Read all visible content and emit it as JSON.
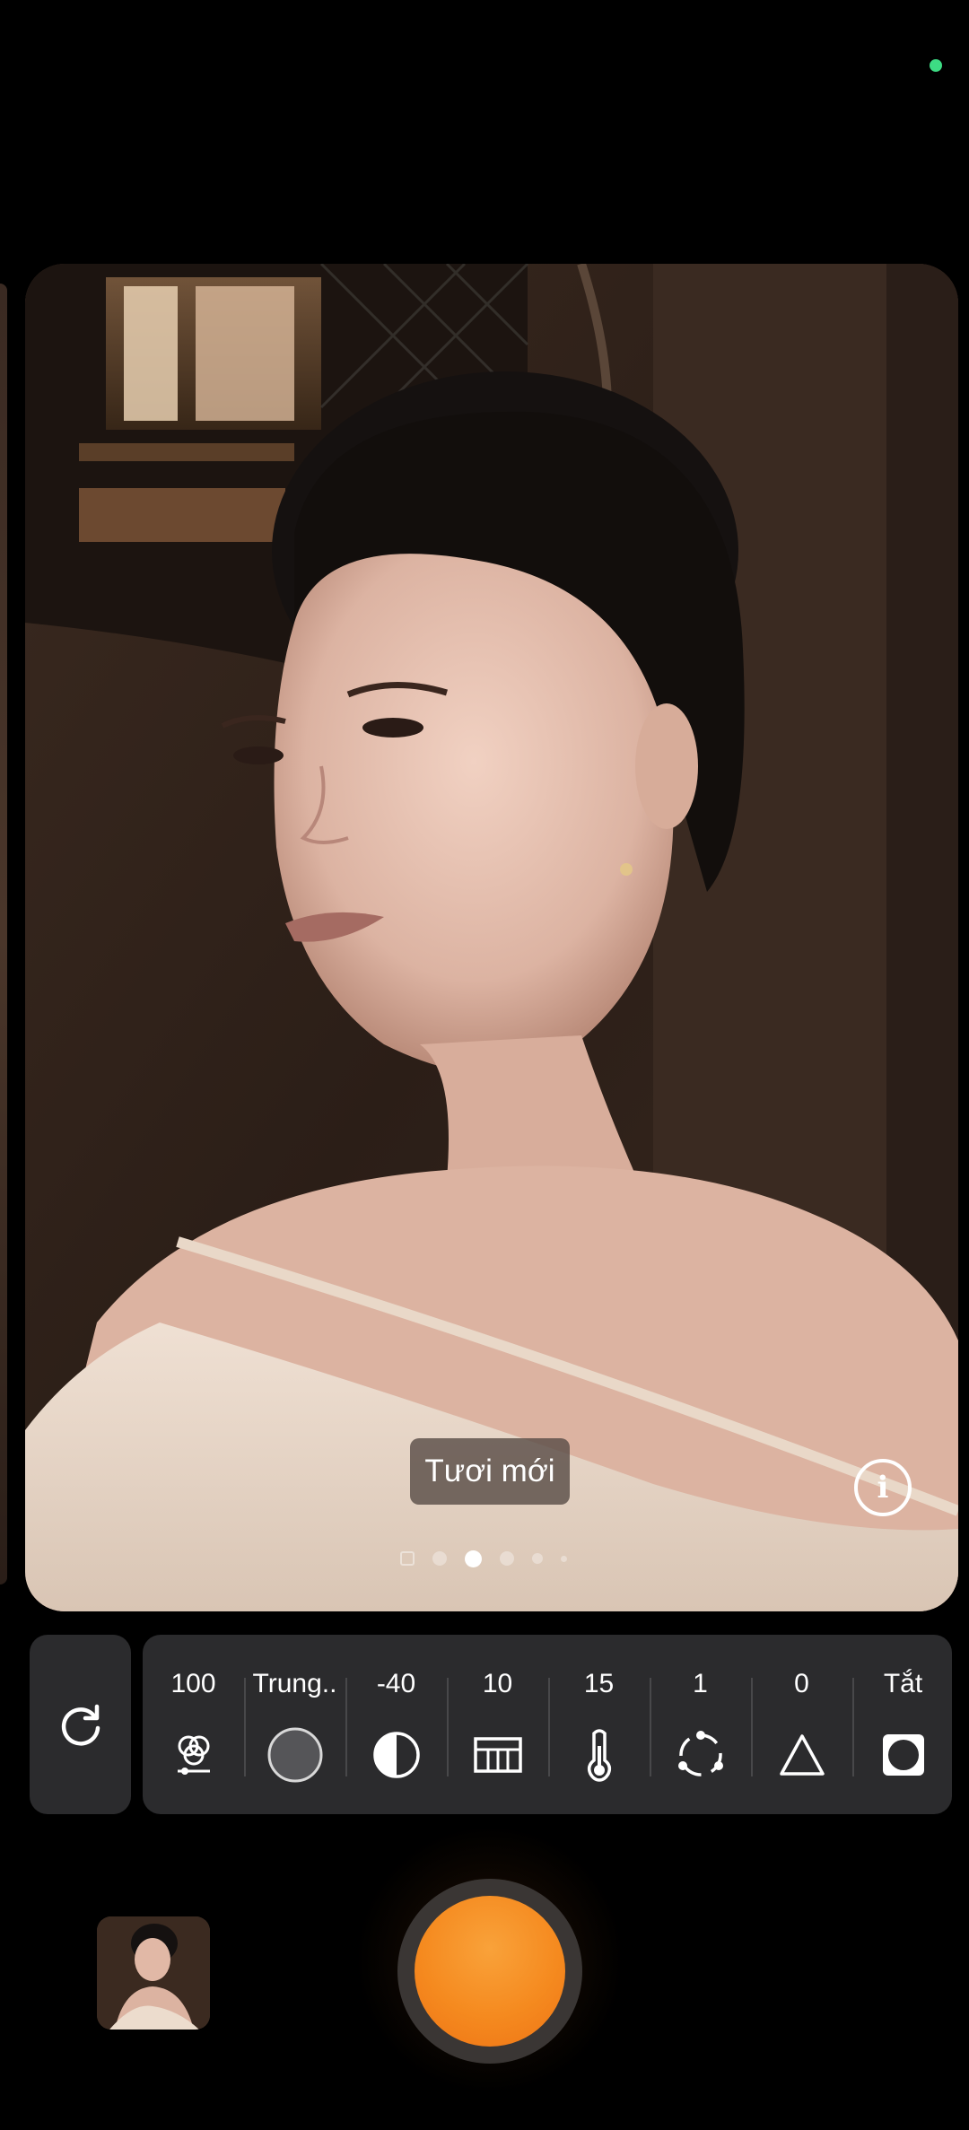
{
  "filter": {
    "label": "Tươi mới",
    "info_icon": "info-icon",
    "pages_total": 6,
    "page_active": 3
  },
  "params": [
    {
      "value": "100",
      "icon": "filter-strength-icon"
    },
    {
      "value": "Trung..",
      "icon": "grain-circle-icon"
    },
    {
      "value": "-40",
      "icon": "contrast-icon"
    },
    {
      "value": "10",
      "icon": "film-grid-icon"
    },
    {
      "value": "15",
      "icon": "temperature-icon"
    },
    {
      "value": "1",
      "icon": "dotted-circle-icon"
    },
    {
      "value": "0",
      "icon": "triangle-icon"
    },
    {
      "value": "Tắt",
      "icon": "vignette-icon"
    }
  ],
  "controls": {
    "reset_icon": "refresh-icon",
    "gallery_icon": "gallery-thumbnail",
    "shutter_icon": "shutter-button"
  },
  "colors": {
    "accent": "#f58a1f",
    "panel": "#2b2b2d",
    "status_dot": "#3ddc84"
  }
}
